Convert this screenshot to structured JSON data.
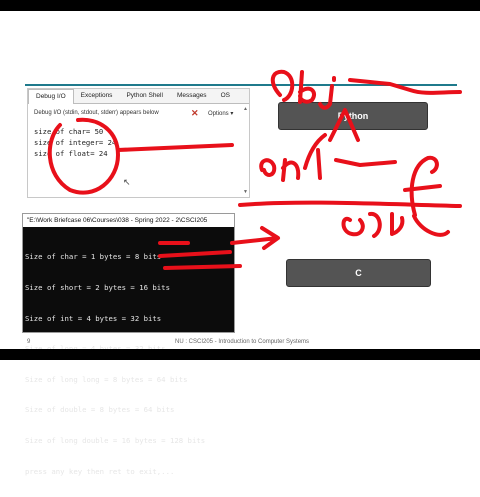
{
  "debug_panel": {
    "tabs": [
      {
        "label": "Debug I/O",
        "active": true
      },
      {
        "label": "Exceptions",
        "active": false
      },
      {
        "label": "Python Shell",
        "active": false
      },
      {
        "label": "Messages",
        "active": false
      },
      {
        "label": "OS",
        "active": false
      }
    ],
    "toolbar_label": "Debug I/O (stdin, stdout, stderr) appears below",
    "options_label": "Options ▾",
    "output": [
      "size of char= 50",
      "size of integer= 24",
      "size of float= 24"
    ]
  },
  "console": {
    "title": "\"E:\\Work Briefcase 06\\Courses\\038 - Spring 2022 - 2\\CSCI205",
    "lines": [
      "Size of char = 1 bytes = 8 bits",
      "Size of short = 2 bytes = 16 bits",
      "Size of int = 4 bytes = 32 bits",
      "Size of long = 4 bytes = 32 bits",
      "Size of long long = 8 bytes = 64 bits",
      "Size of double = 8 bytes = 64 bits",
      "Size of long double = 16 bytes = 128 bits",
      "press any key then ret to exit,..."
    ]
  },
  "buttons": {
    "python": "Python",
    "c": "C"
  },
  "footer": {
    "slide_number": "9",
    "course": "NU : CSCI205 - Introduction to Computer Systems"
  },
  "colors": {
    "ink": "#e8101a",
    "accent_rule": "#1f7a8c"
  }
}
